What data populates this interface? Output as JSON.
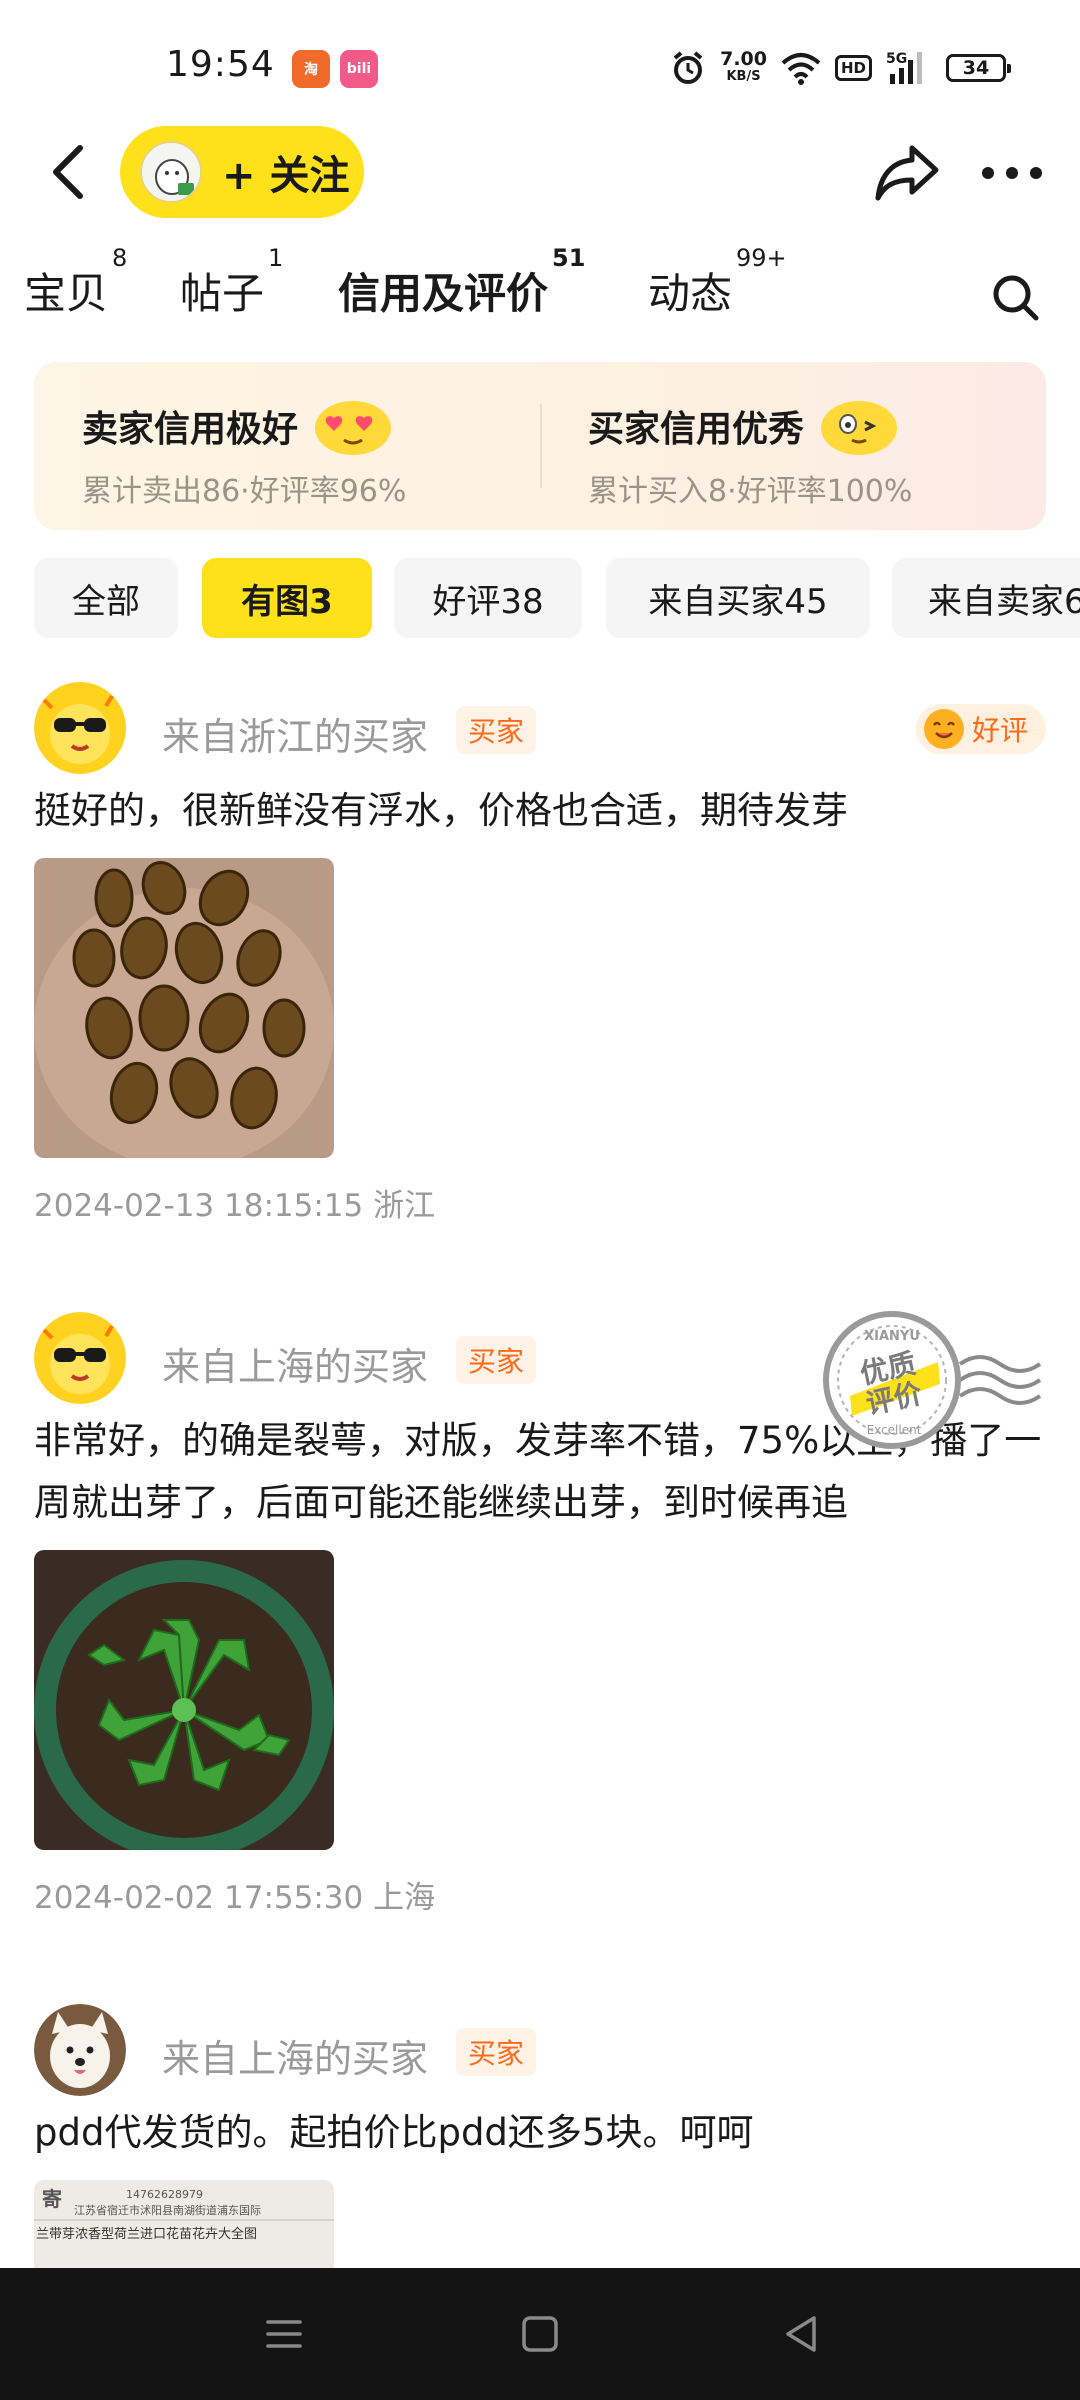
{
  "status_bar": {
    "time": "19:54",
    "net_speed": "7.00",
    "net_unit": "KB/S",
    "hd": "HD",
    "signal": "5G",
    "battery": "34",
    "icons": [
      "app-notification-icon",
      "bilibili-icon",
      "alarm-icon",
      "wifi-icon",
      "signal-icon",
      "battery-icon"
    ]
  },
  "nav": {
    "follow_label": "+ 关注",
    "icons": [
      "back-icon",
      "share-icon",
      "more-icon"
    ]
  },
  "tabs": [
    {
      "label": "宝贝",
      "count": "8"
    },
    {
      "label": "帖子",
      "count": "1"
    },
    {
      "label": "信用及评价",
      "count": "51"
    },
    {
      "label": "动态",
      "count": "99+"
    }
  ],
  "credit": {
    "seller_title": "卖家信用极好",
    "seller_sub": "累计卖出86·好评率96%",
    "buyer_title": "买家信用优秀",
    "buyer_sub": "累计买入8·好评率100%"
  },
  "filters": [
    {
      "label": "全部"
    },
    {
      "label": "有图3"
    },
    {
      "label": "好评38"
    },
    {
      "label": "来自买家45"
    },
    {
      "label": "来自卖家6"
    }
  ],
  "reviews": [
    {
      "name": "来自浙江的买家",
      "badge": "买家",
      "rating": "好评",
      "text": "挺好的，很新鲜没有浮水，价格也合适，期待发芽",
      "meta": "2024-02-13 18:15:15  浙江"
    },
    {
      "name": "来自上海的买家",
      "badge": "买家",
      "text": "非常好，的确是裂萼，对版，发芽率不错，75%以上，播了一周就出芽了，后面可能还能继续出芽，到时候再追",
      "meta": "2024-02-02 17:55:30  上海"
    },
    {
      "name": "来自上海的买家",
      "badge": "买家",
      "text": "pdd代发货的。起拍价比pdd还多5块。呵呵"
    }
  ],
  "stamp": {
    "top": "XIANYU",
    "line1": "优质",
    "line2": "评价",
    "bottom": "Excellent"
  },
  "package_label": {
    "line1": "寄",
    "line2": "14762628979",
    "line3": "江苏省宿迁市沭阳县南湖街道浦东国际",
    "line4": "兰带芽浓香型荷兰进口花苗花卉大全图"
  },
  "colors": {
    "accent_yellow": "#ffe11b",
    "badge_orange": "#ff6a1a",
    "muted_text": "#9a9a9a"
  }
}
